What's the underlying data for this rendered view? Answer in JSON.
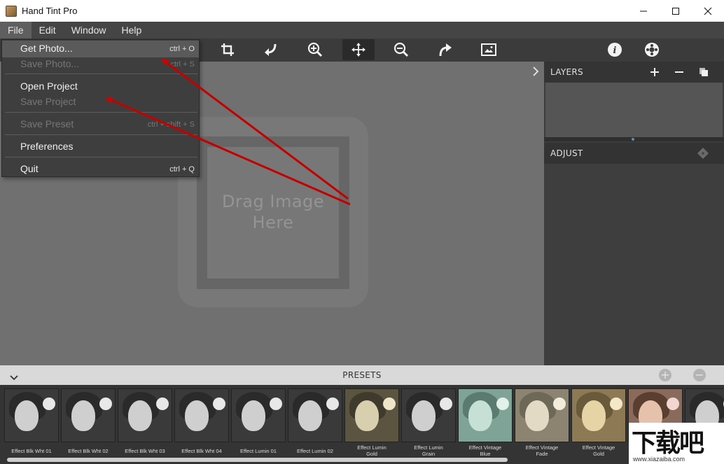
{
  "window": {
    "title": "Hand Tint Pro",
    "controls": [
      "minimize-icon",
      "maximize-icon",
      "close-icon"
    ]
  },
  "menubar": {
    "items": [
      {
        "label": "File",
        "active": true
      },
      {
        "label": "Edit"
      },
      {
        "label": "Window"
      },
      {
        "label": "Help"
      }
    ]
  },
  "file_menu": {
    "items": [
      {
        "label": "Get Photo...",
        "shortcut": "ctrl + O",
        "enabled": true,
        "hover": true
      },
      {
        "label": "Save Photo...",
        "shortcut": "ctrl + S",
        "enabled": false
      },
      {
        "label": "Open Project",
        "shortcut": "",
        "enabled": true
      },
      {
        "label": "Save Project",
        "shortcut": "",
        "enabled": false
      },
      {
        "label": "Save Preset",
        "shortcut": "ctrl + shift + S",
        "enabled": false
      },
      {
        "label": "Preferences",
        "shortcut": "",
        "enabled": true
      },
      {
        "label": "Quit",
        "shortcut": "ctrl + Q",
        "enabled": true
      }
    ]
  },
  "toolbar": {
    "tools": [
      "crop-icon",
      "undo-icon",
      "zoom-in-icon",
      "move-icon",
      "zoom-out-icon",
      "redo-icon",
      "fit-image-icon",
      "info-icon",
      "settings-icon"
    ],
    "selected": "move-icon"
  },
  "canvas": {
    "drop_text_line1": "Drag Image",
    "drop_text_line2": "Here"
  },
  "layers": {
    "title": "LAYERS",
    "actions": [
      "add-layer-icon",
      "remove-layer-icon",
      "duplicate-layer-icon"
    ]
  },
  "adjust": {
    "title": "ADJUST"
  },
  "presets": {
    "title": "PRESETS",
    "items": [
      {
        "label1": "Effect Blk Wht 01",
        "label2": "",
        "tone": "bw"
      },
      {
        "label1": "Effect Blk Wht 02",
        "label2": "",
        "tone": "bw"
      },
      {
        "label1": "Effect Blk Wht 03",
        "label2": "",
        "tone": "bw"
      },
      {
        "label1": "Effect Blk Wht 04",
        "label2": "",
        "tone": "bw"
      },
      {
        "label1": "Effect Lumin 01",
        "label2": "",
        "tone": "bw"
      },
      {
        "label1": "Effect Lumin 02",
        "label2": "",
        "tone": "bw"
      },
      {
        "label1": "Effect Lumin",
        "label2": "Gold",
        "tone": "gold"
      },
      {
        "label1": "Effect Lumin",
        "label2": "Grain",
        "tone": "bw"
      },
      {
        "label1": "Effect Vintage",
        "label2": "Blue",
        "tone": "blue"
      },
      {
        "label1": "Effect Vintage",
        "label2": "Fade",
        "tone": "fade"
      },
      {
        "label1": "Effect Vintage",
        "label2": "Gold",
        "tone": "vgold"
      },
      {
        "label1": "",
        "label2": "",
        "tone": "color"
      },
      {
        "label1": "",
        "label2": "",
        "tone": "bw"
      }
    ]
  },
  "watermark": {
    "big": "下载吧",
    "small": "www.xiazaiba.com"
  },
  "colors": {
    "annotation_arrow": "#d40000",
    "canvas_bg": "#707070",
    "menu_bg": "#454545"
  }
}
